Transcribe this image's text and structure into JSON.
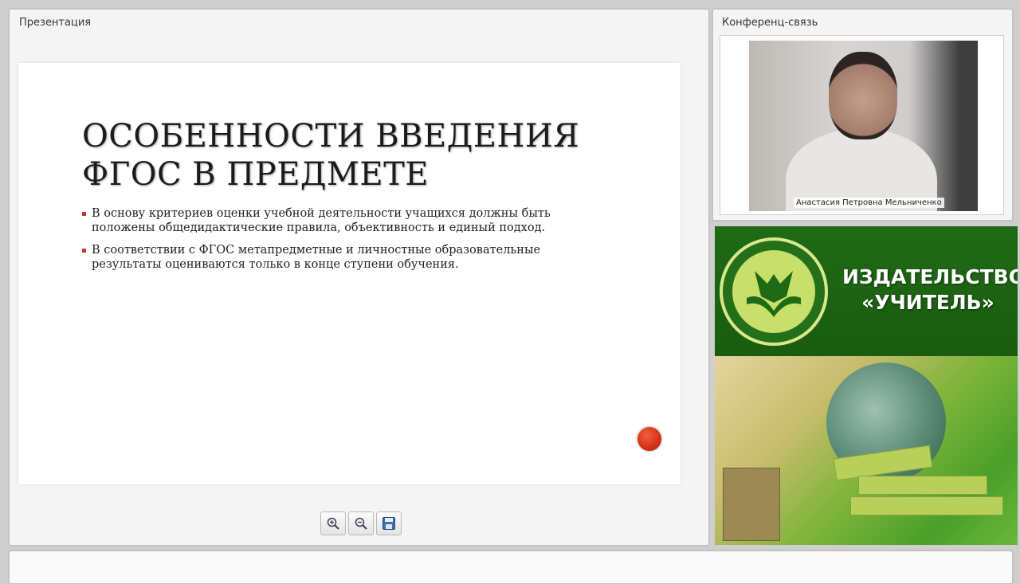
{
  "presentation": {
    "panel_title": "Презентация",
    "slide": {
      "title": "ОСОБЕННОСТИ ВВЕДЕНИЯ ФГОС В ПРЕДМЕТЕ",
      "bullets": [
        "В основу критериев оценки учебной деятельности учащихся должны быть положены общедидактические правила, объективность и единый подход.",
        "В соответствии с ФГОС метапредметные и личностные образовательные результаты оцениваются только в конце ступени обучения."
      ]
    },
    "toolbar": {
      "zoom_in_icon": "zoom-in-icon",
      "zoom_out_icon": "zoom-out-icon",
      "save_icon": "floppy-disk-icon"
    }
  },
  "conference": {
    "panel_title": "Конференц-связь",
    "participant_name": "Анастасия Петровна Мельниченко"
  },
  "banner": {
    "line1": "ИЗДАТЕЛЬСТВО",
    "line2": "«УЧИТЕЛЬ»"
  },
  "colors": {
    "accent_red": "#c0392b",
    "banner_green": "#1f6a15"
  }
}
